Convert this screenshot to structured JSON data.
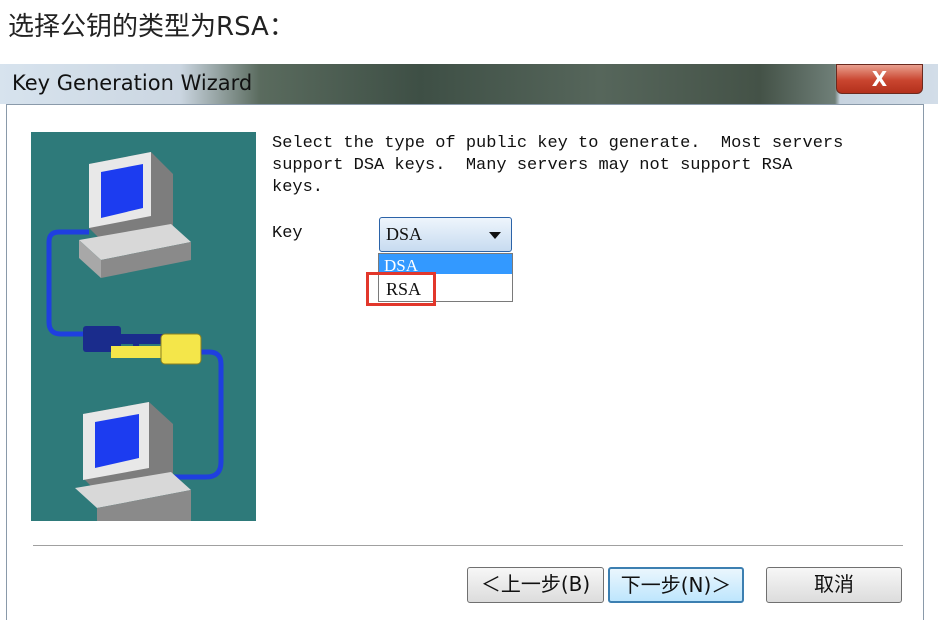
{
  "caption": "选择公钥的类型为RSA：",
  "window": {
    "title": "Key Generation Wizard",
    "close_glyph": "X"
  },
  "content": {
    "description": "Select the type of public key to generate.  Most servers\nsupport DSA keys.  Many servers may not support RSA\nkeys.",
    "key_label": "Key",
    "combo_value": "DSA",
    "options": [
      "DSA",
      "RSA"
    ],
    "highlighted_option": "RSA"
  },
  "buttons": {
    "back": "＜上一步(B)",
    "next": "下一步(N)＞",
    "cancel": "取消"
  },
  "colors": {
    "illustration_bg": "#2e7a7a",
    "highlight_border": "#e2372b",
    "selection": "#3399ff"
  }
}
